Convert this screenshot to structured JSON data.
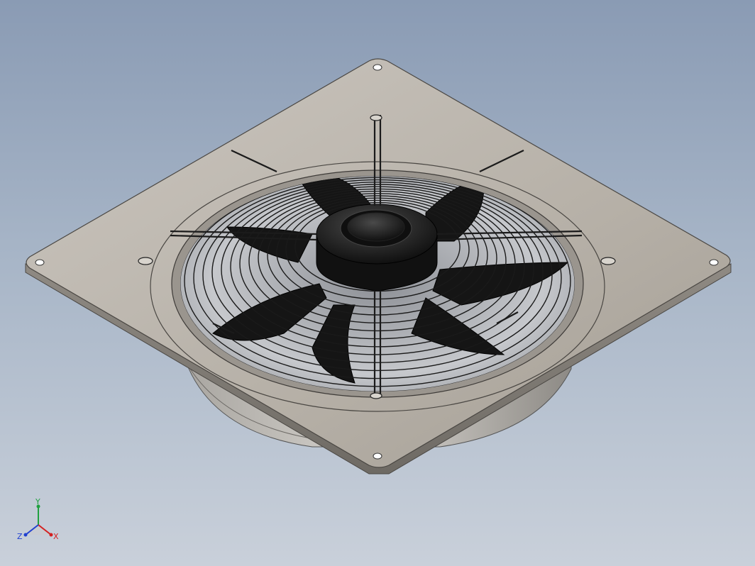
{
  "triad": {
    "x_label": "X",
    "y_label": "Y",
    "z_label": "Z",
    "x_color": "#d42020",
    "y_color": "#20a040",
    "z_color": "#2040d0"
  },
  "colors": {
    "background_top": "#8a9bb4",
    "background_bottom": "#c9d0da",
    "plate": "#b9b3aa",
    "blade": "#161616",
    "wire": "#222222"
  }
}
